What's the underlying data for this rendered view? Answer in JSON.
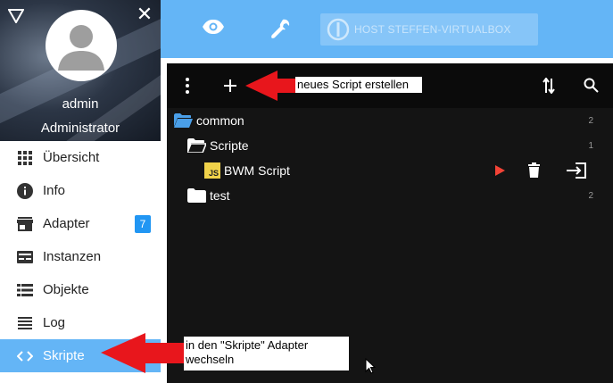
{
  "profile": {
    "username": "admin",
    "role": "Administrator"
  },
  "menu": {
    "items": [
      {
        "label": "Übersicht",
        "icon": "grid-icon"
      },
      {
        "label": "Info",
        "icon": "info-icon"
      },
      {
        "label": "Adapter",
        "icon": "store-icon",
        "badge": "7"
      },
      {
        "label": "Instanzen",
        "icon": "instances-icon"
      },
      {
        "label": "Objekte",
        "icon": "list-icon"
      },
      {
        "label": "Log",
        "icon": "log-icon"
      },
      {
        "label": "Skripte",
        "icon": "code-icon",
        "active": true
      }
    ]
  },
  "topbar": {
    "host_label": "HOST STEFFEN-VIRTUALBOX"
  },
  "tree": [
    {
      "label": "common",
      "icon": "folder-open-icon",
      "count": "2"
    },
    {
      "label": "Scripte",
      "icon": "folder-open-icon",
      "count": "1"
    },
    {
      "label": "BWM Script",
      "icon": "js-icon"
    },
    {
      "label": "test",
      "icon": "folder-icon",
      "count": "2"
    }
  ],
  "annotations": {
    "new_script": "neues Script erstellen",
    "switch_adapter": "in den \"Skripte\" Adapter wechseln"
  },
  "colors": {
    "accent": "#64b5f6",
    "badge": "#2196f3",
    "panel_bg": "#141414",
    "arrow": "#e8161c",
    "run": "#f44336",
    "folder_blue": "#4a9fe8",
    "js_yellow": "#f0d24a"
  }
}
